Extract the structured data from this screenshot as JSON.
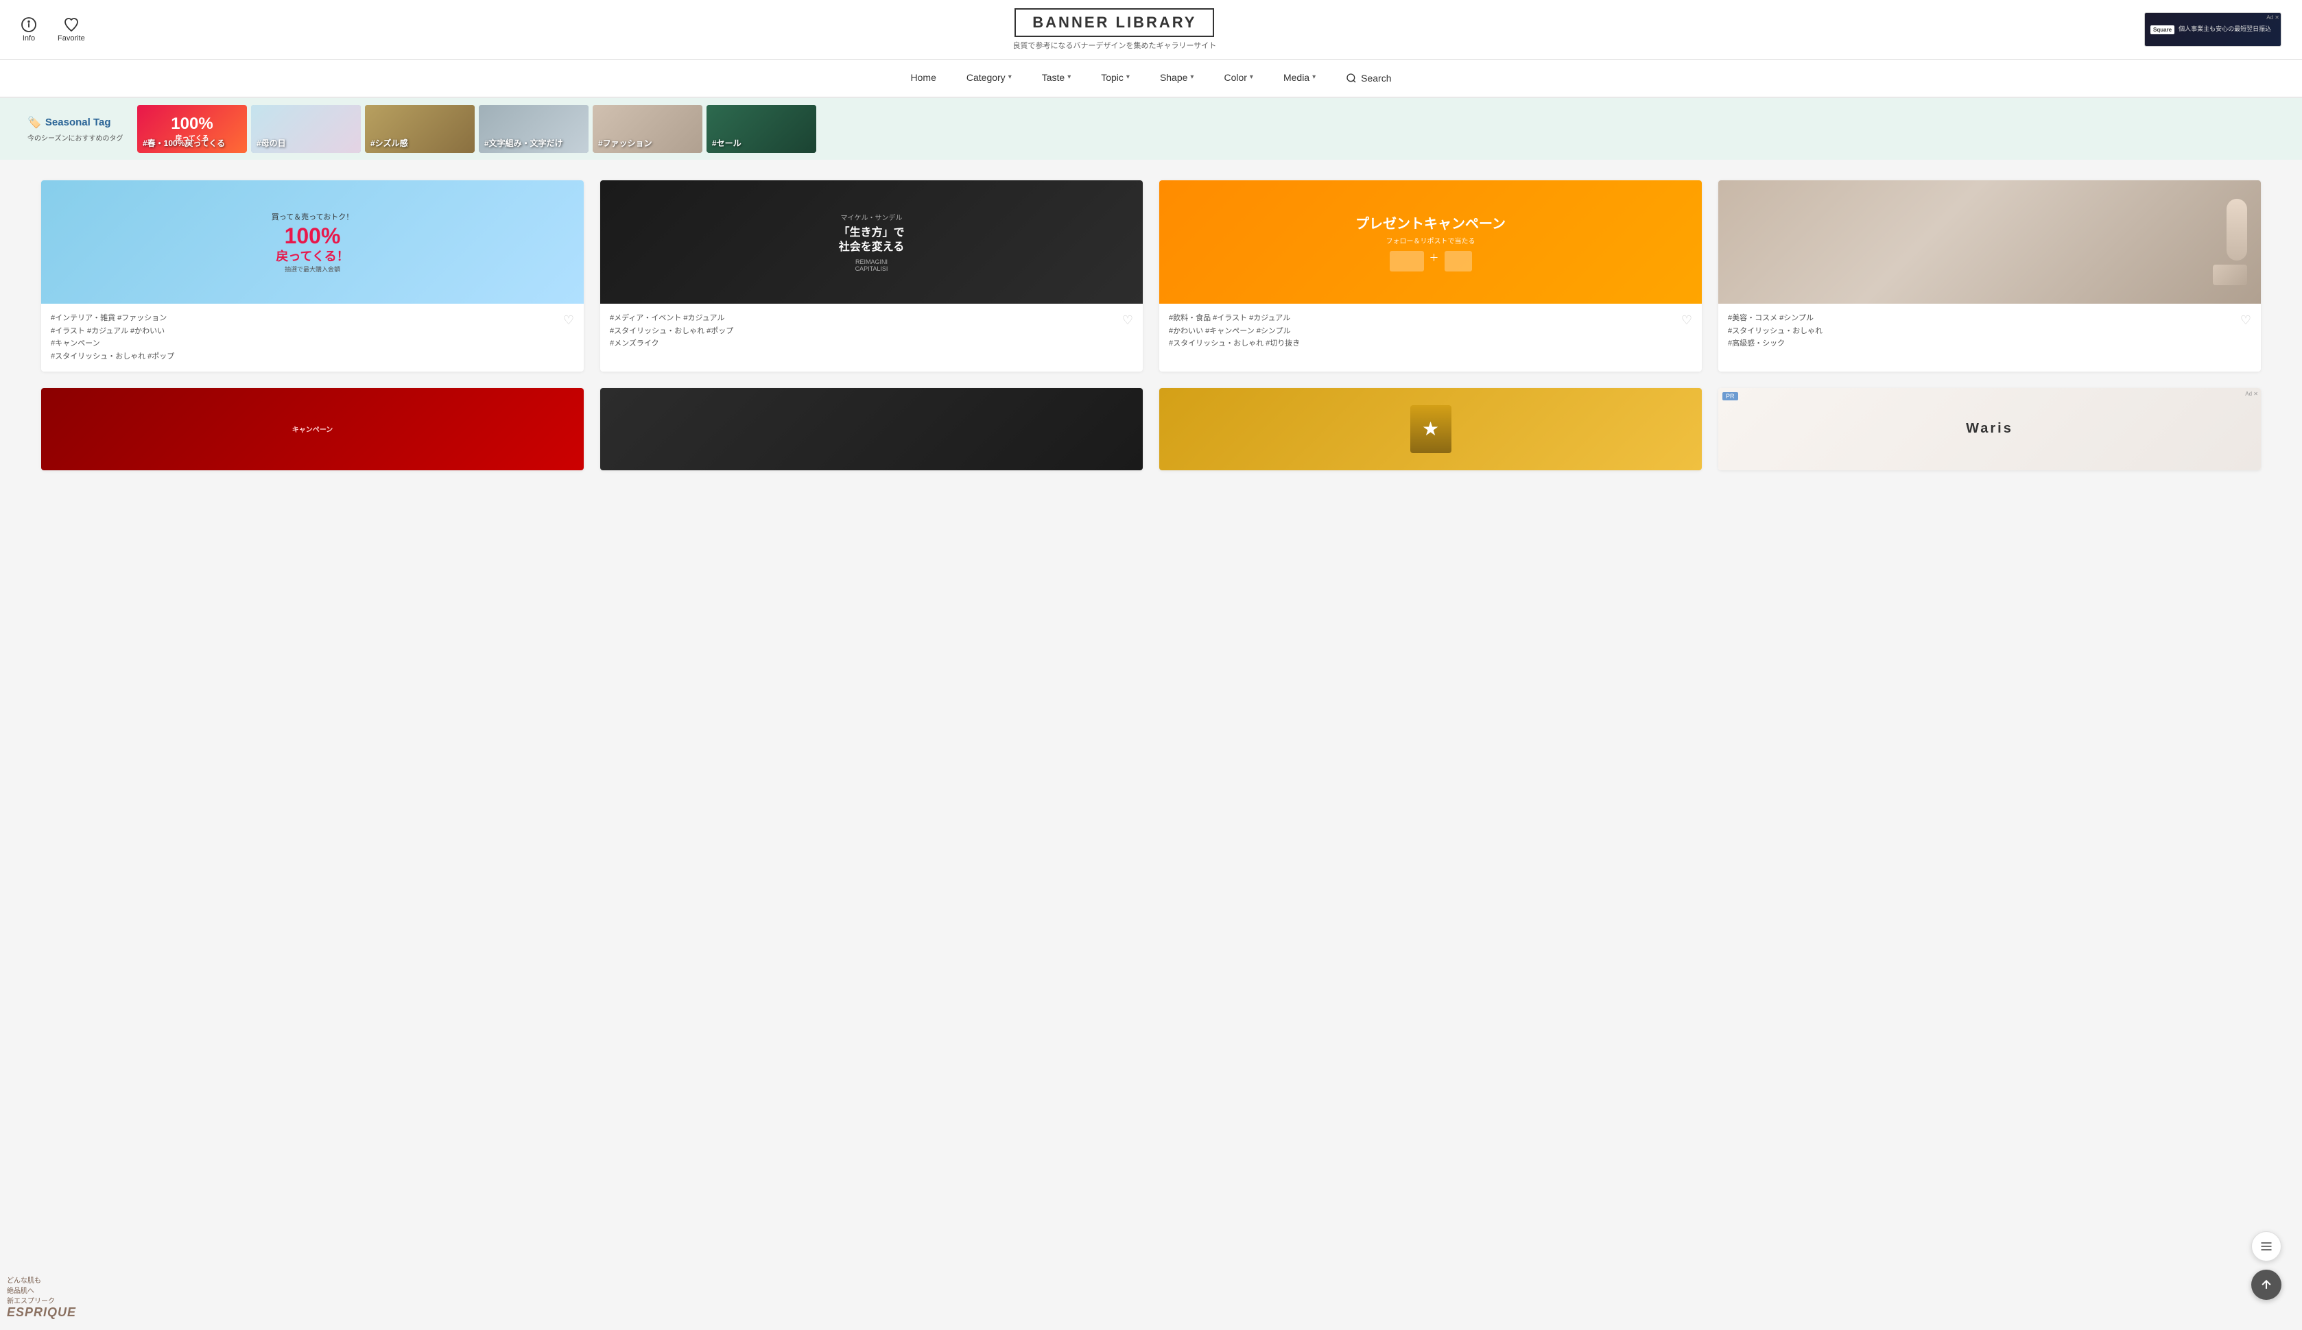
{
  "header": {
    "info_label": "Info",
    "favorite_label": "Favorite",
    "logo_title": "BANNER LIBRARY",
    "logo_subtitle": "良質で参考になるバナーデザインを集めたギャラリーサイト",
    "ad_text": "個人事業主も安心の最短翌日振込"
  },
  "nav": {
    "items": [
      {
        "label": "Home",
        "has_dropdown": false
      },
      {
        "label": "Category",
        "has_dropdown": true
      },
      {
        "label": "Taste",
        "has_dropdown": true
      },
      {
        "label": "Topic",
        "has_dropdown": true
      },
      {
        "label": "Shape",
        "has_dropdown": true
      },
      {
        "label": "Color",
        "has_dropdown": true
      },
      {
        "label": "Media",
        "has_dropdown": true
      }
    ],
    "search_label": "Search"
  },
  "seasonal": {
    "title": "Seasonal Tag",
    "subtitle": "今のシーズンにおすすめのタグ",
    "tags": [
      {
        "label": "#春・100%戻ってくる"
      },
      {
        "label": "#母の日"
      },
      {
        "label": "#シズル感"
      },
      {
        "label": "#文字組み・文字だけ"
      },
      {
        "label": "#ファッション"
      },
      {
        "label": "#セール"
      }
    ]
  },
  "cards": [
    {
      "id": 1,
      "tags": "#インテリア・雑貨  #ファッション\n#イラスト  #カジュアル  #かわいい\n#キャンペーン\n#スタイリッシュ・おしゃれ  #ポップ"
    },
    {
      "id": 2,
      "tags": "#メディア・イベント  #カジュアル\n#スタイリッシュ・おしゃれ  #ポップ\n#メンズライク"
    },
    {
      "id": 3,
      "tags": "#飲料・食品  #イラスト  #カジュアル\n#かわいい  #キャンペーン  #シンプル\n#スタイリッシュ・おしゃれ  #切り抜き"
    },
    {
      "id": 4,
      "tags": "#美容・コスメ  #シンプル\n#スタイリッシュ・おしゃれ\n#高級感・シック"
    }
  ],
  "cards_row2": [
    {
      "id": 5,
      "tags": ""
    },
    {
      "id": 6,
      "tags": ""
    },
    {
      "id": 7,
      "tags": ""
    },
    {
      "id": 8,
      "tags": "",
      "is_ad": true
    }
  ],
  "floating": {
    "menu_icon": "≡",
    "top_icon": "↑"
  }
}
